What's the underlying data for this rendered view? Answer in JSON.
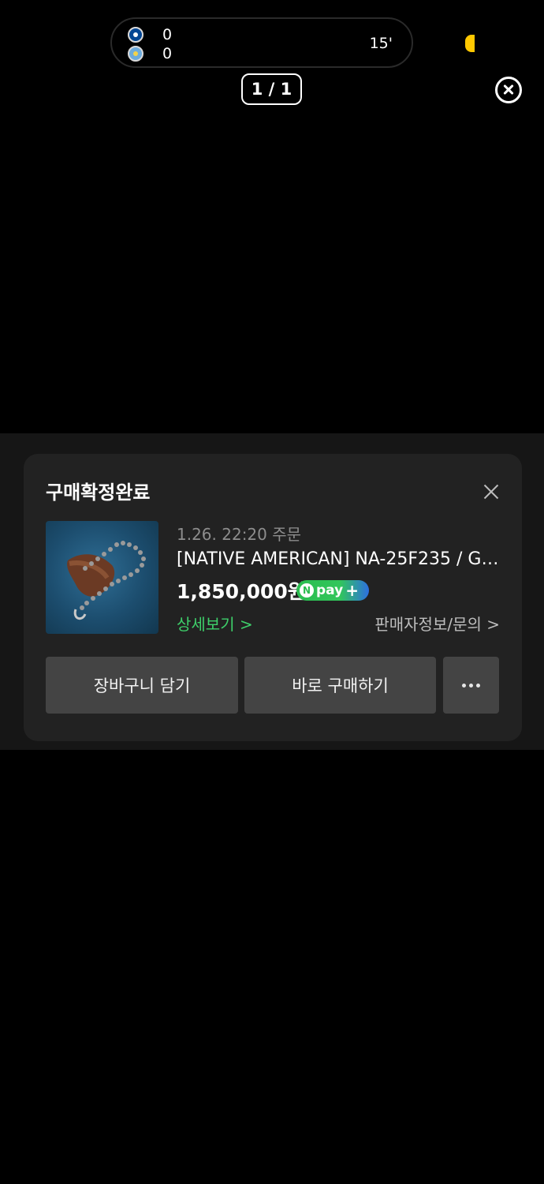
{
  "score_widget": {
    "home_score": "0",
    "away_score": "0",
    "minute": "15'",
    "home_team_icon": "chelsea-crest-icon",
    "away_team_icon": "man-city-crest-icon"
  },
  "viewer": {
    "page_counter": "1 / 1",
    "close_icon": "close-circle-icon"
  },
  "purchase_card": {
    "title": "구매확정완료",
    "order_date": "1.26. 22:20 주문",
    "product_name": "[NATIVE AMERICAN] NA-25F235 / GI...",
    "price": "1,850,000원",
    "npay_label": "pay",
    "npay_n": "N",
    "npay_plus": "+",
    "detail_link": "상세보기 >",
    "seller_link": "판매자정보/문의 >",
    "cart_button": "장바구니 담기",
    "buy_button": "바로 구매하기",
    "more_icon": "more-horizontal-icon"
  },
  "colors": {
    "background": "#000000",
    "card": "#222222",
    "button": "#444444",
    "accent_green": "#3ecf6a",
    "npay_green": "#2bbd4f",
    "yellow_tab": "#ffc800"
  }
}
